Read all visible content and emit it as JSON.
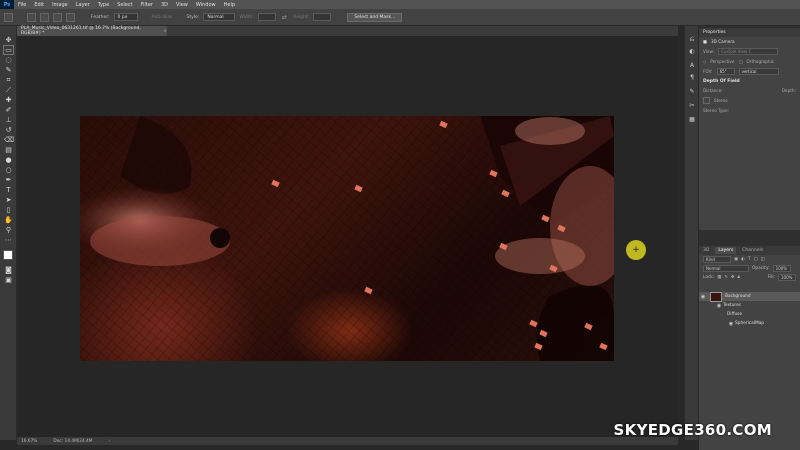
{
  "app": {
    "logo": "Ps"
  },
  "menu": [
    "File",
    "Edit",
    "Image",
    "Layer",
    "Type",
    "Select",
    "Filter",
    "3D",
    "View",
    "Window",
    "Help"
  ],
  "options": {
    "feather_label": "Feather:",
    "feather_value": "0 px",
    "antialias_label": "Anti-alias",
    "style_label": "Style:",
    "style_value": "Normal",
    "width_label": "Width:",
    "height_label": "Height:",
    "select_mask_button": "Select and Mask..."
  },
  "document": {
    "tab_title": "PLA_Music_Video_0631261.tif @ 16.7% (Background, RGB/8#) *",
    "zoom": "16.67%",
    "doc_info": "Doc: 14.4M/24.4M"
  },
  "properties": {
    "title": "Properties",
    "section": "3D Camera",
    "view_label": "View:",
    "view_value": "Custom View 1",
    "perspective": "Perspective",
    "orthographic": "Orthographic",
    "fov_label": "FOV:",
    "fov_value": "65°",
    "fov_mode": "vertical",
    "depth_of_field": "Depth Of Field",
    "distance_label": "Distance:",
    "depth_label": "Depth:",
    "stereo_label": "Stereo",
    "stereo_type_label": "Stereo Type:"
  },
  "layers_panel": {
    "tabs": [
      "3D",
      "Layers",
      "Channels"
    ],
    "active_tab": "Layers",
    "filter_kind": "Kind",
    "blend_mode": "Normal",
    "opacity_label": "Opacity:",
    "opacity_value": "100%",
    "lock_label": "Lock:",
    "fill_label": "Fill:",
    "fill_value": "100%",
    "items": [
      {
        "name": "Background"
      },
      {
        "name": "Textures"
      },
      {
        "name": "Diffuse"
      },
      {
        "name": "SphericalMap"
      }
    ]
  },
  "watermark": "SKYEDGE360.COM",
  "colors": {
    "accent": "#31a8ff",
    "cursor": "#dcd21e"
  }
}
